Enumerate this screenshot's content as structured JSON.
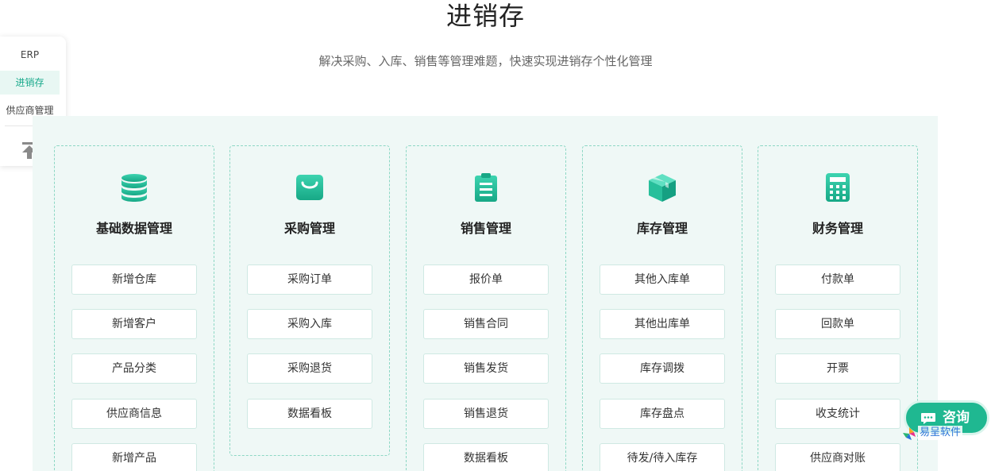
{
  "header": {
    "title": "进销存",
    "subtitle": "解决采购、入库、销售等管理难题，快速实现进销存个性化管理"
  },
  "sidebar": {
    "items": [
      {
        "label": "ERP"
      },
      {
        "label": "进销存",
        "active": true
      },
      {
        "label": "供应商管理"
      }
    ],
    "back_to_top_icon": "arrow-up-to-top-icon"
  },
  "accent_color": "#1fb891",
  "modules": [
    {
      "title": "基础数据管理",
      "icon": "database-icon",
      "actions": [
        "新增仓库",
        "新增客户",
        "产品分类",
        "供应商信息",
        "新增产品"
      ]
    },
    {
      "title": "采购管理",
      "icon": "shopping-bag-icon",
      "actions": [
        "采购订单",
        "采购入库",
        "采购退货",
        "数据看板"
      ]
    },
    {
      "title": "销售管理",
      "icon": "clipboard-icon",
      "actions": [
        "报价单",
        "销售合同",
        "销售发货",
        "销售退货",
        "数据看板"
      ]
    },
    {
      "title": "库存管理",
      "icon": "box-icon",
      "actions": [
        "其他入库单",
        "其他出库单",
        "库存调拨",
        "库存盘点",
        "待发/待入库存"
      ]
    },
    {
      "title": "财务管理",
      "icon": "calculator-icon",
      "actions": [
        "付款单",
        "回款单",
        "开票",
        "收支统计",
        "供应商对账"
      ]
    }
  ],
  "consult": {
    "label": "咨询",
    "icon": "chat-bubble-icon"
  },
  "brand": {
    "text": "易呈软件",
    "icon": "brand-logo-icon"
  }
}
